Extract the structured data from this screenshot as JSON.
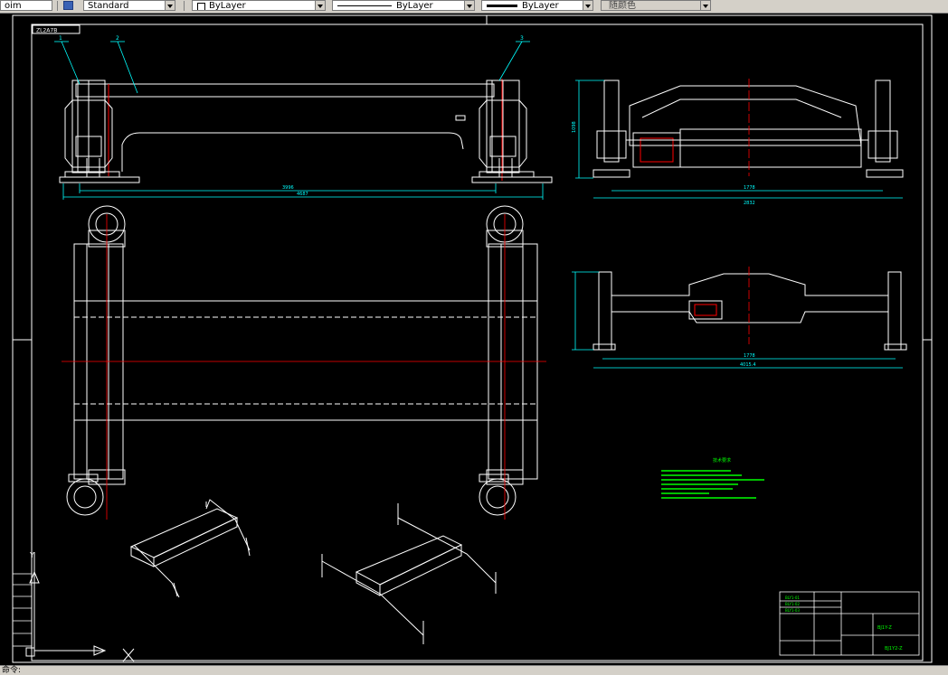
{
  "toolbar": {
    "text_style_prefix": "oim",
    "text_style": "Standard",
    "layer_color": "ByLayer",
    "linetype": "ByLayer",
    "lineweight": "ByLayer",
    "plot_style": "随颜色"
  },
  "drawing": {
    "frame_label": "ZL2A7B",
    "balloons": [
      "1",
      "2",
      "3"
    ],
    "dim_front_inner": "3996",
    "dim_front_outer": "4687",
    "dim_side_upper_inner": "1778",
    "dim_side_upper_outer": "2832",
    "dim_side_lower_inner": "1778",
    "dim_side_lower_outer": "4015.4",
    "dim_side_height": "1098",
    "notes_title": "技术要求",
    "title_block": {
      "drawing_name": "BJ1Y-Z",
      "part_no": "BJ1Y2-Z"
    }
  },
  "statusbar": {
    "command_text": "命令:"
  },
  "colors": {
    "frame": "#ffffff",
    "dimension": "#00ffff",
    "center_line": "#ff0000",
    "annotation": "#00ff00",
    "accent": "#ff0000"
  },
  "icons": {
    "ucs": "ucs-icon",
    "crosshair": "crosshair-icon"
  }
}
